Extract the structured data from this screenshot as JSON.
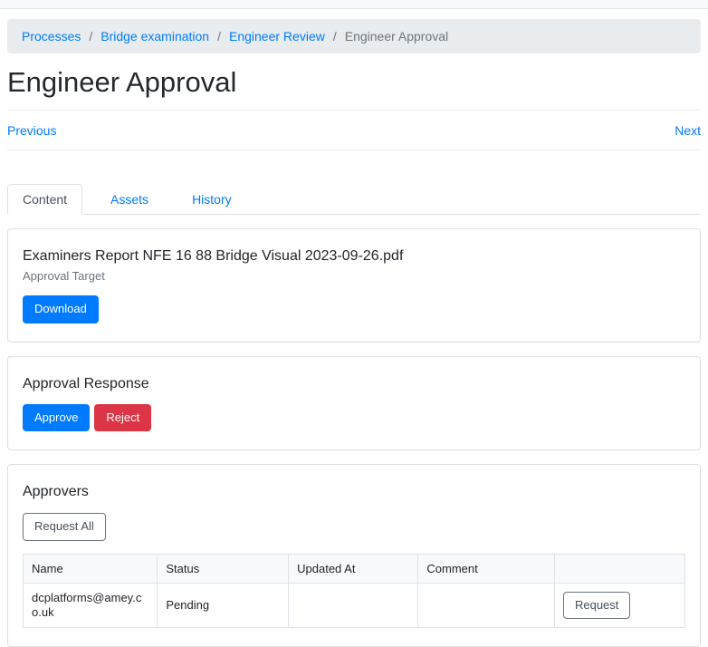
{
  "breadcrumb": {
    "separator": "/",
    "links": [
      {
        "label": "Processes"
      },
      {
        "label": "Bridge examination"
      },
      {
        "label": "Engineer Review"
      }
    ],
    "current": "Engineer Approval"
  },
  "page": {
    "title": "Engineer Approval"
  },
  "pager": {
    "previous_label": "Previous",
    "next_label": "Next"
  },
  "tabs": [
    {
      "label": "Content",
      "active": true
    },
    {
      "label": "Assets",
      "active": false
    },
    {
      "label": "History",
      "active": false
    }
  ],
  "target_card": {
    "filename": "Examiners Report NFE 16 88 Bridge Visual 2023-09-26.pdf",
    "subtitle": "Approval Target",
    "download_label": "Download"
  },
  "response_card": {
    "title": "Approval Response",
    "approve_label": "Approve",
    "reject_label": "Reject"
  },
  "approvers_card": {
    "title": "Approvers",
    "request_all_label": "Request All",
    "table": {
      "headers": [
        "Name",
        "Status",
        "Updated At",
        "Comment",
        ""
      ],
      "rows": [
        {
          "name": "dcplatforms@amey.co.uk",
          "status": "Pending",
          "updated_at": "",
          "comment": "",
          "action_label": "Request"
        }
      ]
    }
  },
  "colors": {
    "primary": "#007bff",
    "danger": "#dc3545",
    "secondary": "#6c757d",
    "border": "#dee2e6",
    "breadcrumb_bg": "#e9ecef",
    "table_header_bg": "#f8f9fa"
  }
}
